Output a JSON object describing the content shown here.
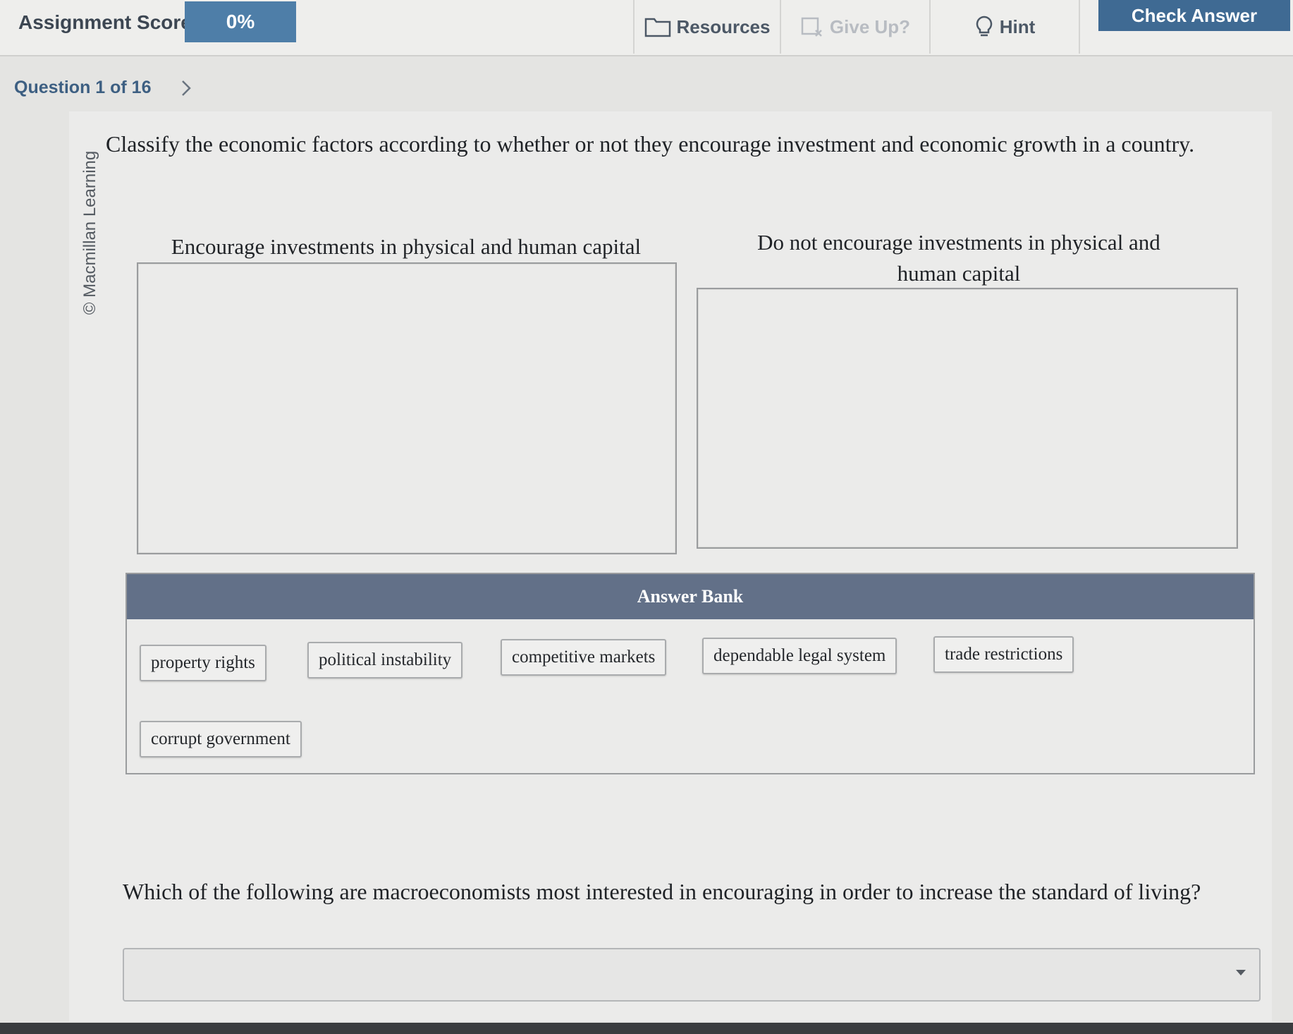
{
  "header": {
    "score_label": "Assignment Score:",
    "score_value": "0%",
    "tools": [
      {
        "label": "Resources",
        "icon": "folder-icon",
        "disabled": false
      },
      {
        "label": "Give Up?",
        "icon": "give-up-icon",
        "disabled": true
      },
      {
        "label": "Hint",
        "icon": "lightbulb-icon",
        "disabled": false
      }
    ],
    "check_answer": "Check Answer"
  },
  "navigation": {
    "question_label": "Question 1 of 16",
    "next_icon": "chevron-right-icon"
  },
  "copyright": "© Macmillan Learning",
  "question": {
    "prompt": "Classify the economic factors according to whether or not they encourage investment and economic growth in a country.",
    "categories": [
      {
        "title": "Encourage investments in physical and human capital"
      },
      {
        "title": "Do not encourage investments in physical and human capital"
      }
    ]
  },
  "answer_bank": {
    "title": "Answer Bank",
    "items": [
      "property rights",
      "political instability",
      "competitive markets",
      "dependable legal system",
      "trade restrictions",
      "corrupt government"
    ]
  },
  "question2": {
    "prompt": "Which of the following are macroeconomists most interested in encouraging in order to increase the standard of living?",
    "selected": ""
  },
  "colors": {
    "score_box": "#4e7ea8",
    "check_button": "#3f6a93",
    "bank_header": "#627088",
    "question_nav": "#3d5f82"
  }
}
